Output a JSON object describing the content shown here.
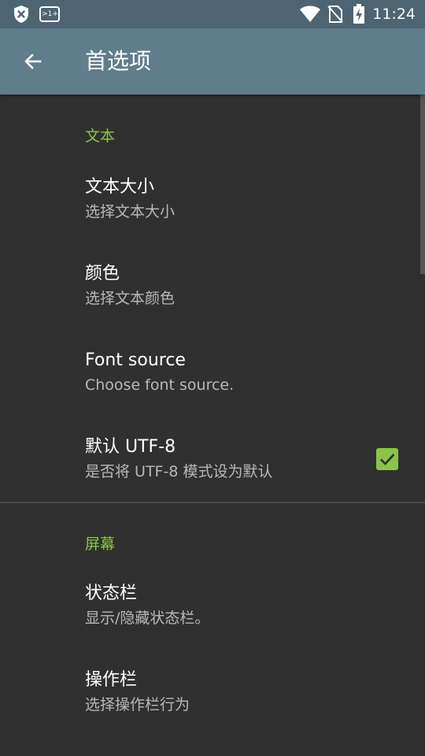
{
  "status_bar": {
    "time": "11:24",
    "icons": [
      "shield-x-icon",
      "data-saver-icon",
      "wifi-icon",
      "no-sim-icon",
      "battery-charging-icon"
    ],
    "data_saver_label": ">1+"
  },
  "app_bar": {
    "title": "首选项",
    "back_icon": "arrow-back-icon"
  },
  "sections": [
    {
      "header": "文本",
      "items": [
        {
          "title": "文本大小",
          "summary": "选择文本大小"
        },
        {
          "title": "颜色",
          "summary": "选择文本颜色"
        },
        {
          "title": "Font source",
          "summary": "Choose font source."
        },
        {
          "title": "默认 UTF-8",
          "summary": "是否将 UTF-8 模式设为默认",
          "checked": true
        }
      ]
    },
    {
      "header": "屏幕",
      "items": [
        {
          "title": "状态栏",
          "summary": "显示/隐藏状态栏。"
        },
        {
          "title": "操作栏",
          "summary": "选择操作栏行为"
        }
      ]
    }
  ],
  "colors": {
    "accent": "#8bc34a",
    "app_bar": "#607d8b",
    "status_bar": "#4d6573",
    "background": "#303030"
  }
}
